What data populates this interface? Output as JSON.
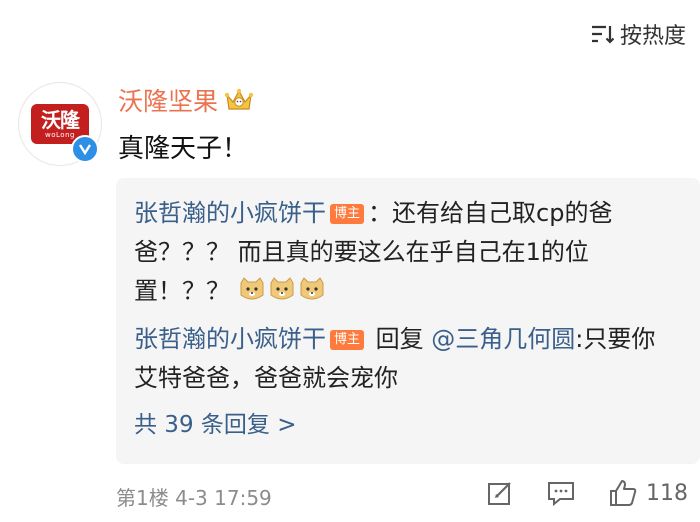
{
  "sort": {
    "label": "按热度"
  },
  "comment": {
    "avatar_logo_text": "沃隆",
    "avatar_logo_sub": "woLong",
    "username": "沃隆坚果",
    "text": "真隆天子！",
    "replies": [
      {
        "nickname": "张哲瀚的小疯饼干",
        "tag": "博主",
        "text": "：还有给自己取cp的爸爸？？？ 而且真的要这么在乎自己在1的位置！？？"
      },
      {
        "nickname": "张哲瀚的小疯饼干",
        "tag": "博主",
        "reply_word": "回复",
        "mention": "@三角几何圆",
        "text": ":只要你艾特爸爸，爸爸就会宠你"
      }
    ],
    "more_replies": "共 39 条回复 >",
    "floor": "第1楼",
    "date": "4-3",
    "time": "17:59",
    "like_count": "118"
  },
  "colors": {
    "accent": "#eb7350",
    "link": "#3a5f8a",
    "tag": "#ff7b3d",
    "verified": "#2d8fe5"
  }
}
